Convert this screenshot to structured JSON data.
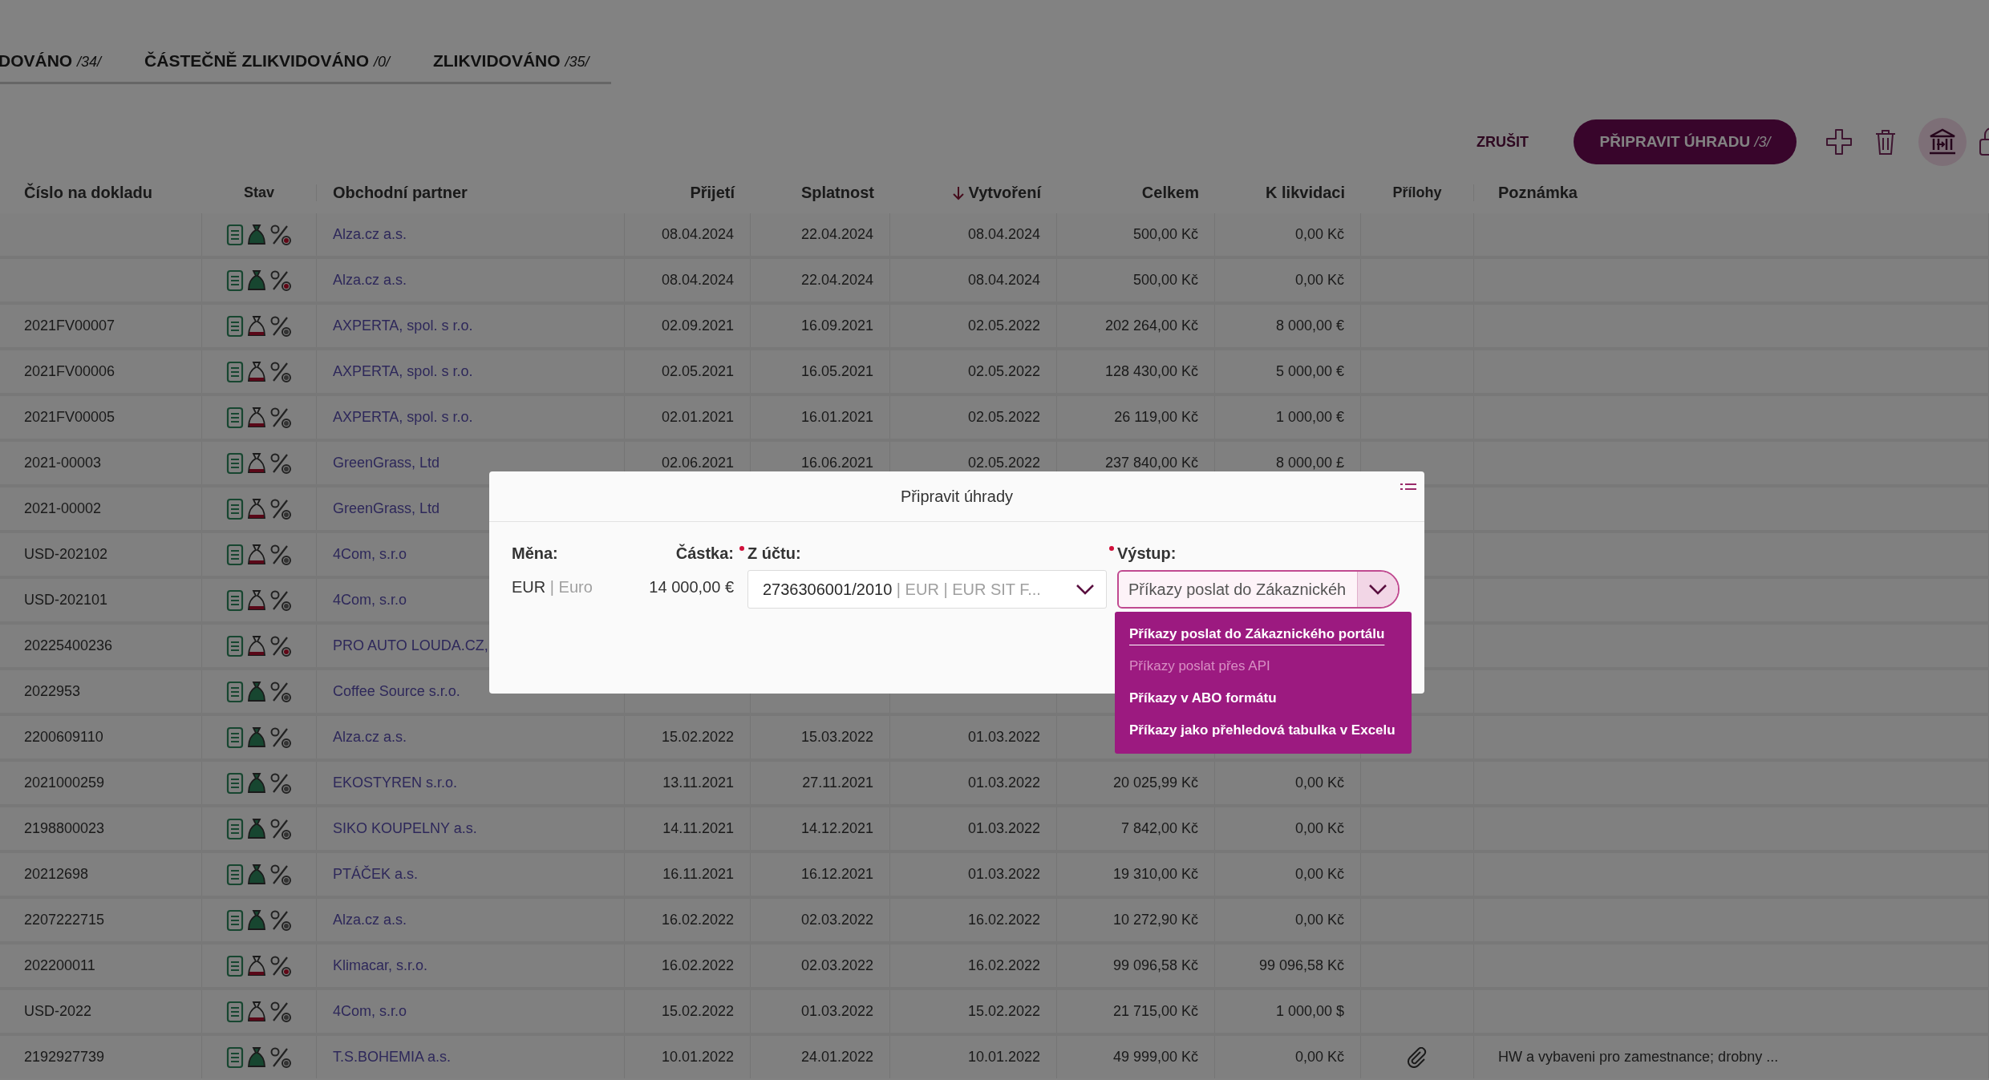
{
  "tabs": [
    {
      "label": "DOVÁNO",
      "count": "/34/",
      "selected": false
    },
    {
      "label": "ČÁSTEČNĚ ZLIKVIDOVÁNO",
      "count": "/0/",
      "selected": false
    },
    {
      "label": "ZLIKVIDOVÁNO",
      "count": "/35/",
      "selected": false
    }
  ],
  "actions": {
    "cancel": "ZRUŠIT",
    "primary": {
      "label": "PŘIPRAVIT ÚHRADU",
      "count": "/3/"
    }
  },
  "table": {
    "columns": [
      {
        "label": "Číslo na dokladu",
        "sorted": false
      },
      {
        "label": "Stav",
        "sorted": false
      },
      {
        "label": "Obchodní partner",
        "sorted": false
      },
      {
        "label": "Přijetí",
        "sorted": false
      },
      {
        "label": "Splatnost",
        "sorted": false
      },
      {
        "label": "Vytvoření",
        "sorted": true
      },
      {
        "label": "Celkem",
        "sorted": false
      },
      {
        "label": "K likvidaci",
        "sorted": false
      },
      {
        "label": "Přílohy",
        "sorted": false
      },
      {
        "label": "Poznámka",
        "sorted": false
      }
    ],
    "rows": [
      {
        "partner": "Alza.cz a.s.",
        "received": "08.04.2024",
        "due": "22.04.2024",
        "created": "08.04.2024",
        "total": "500,00 Kč",
        "to_pay": "0,00 Kč",
        "bag_full": true,
        "percent_alert": true,
        "attachment": false
      },
      {
        "partner": "Alza.cz a.s.",
        "received": "08.04.2024",
        "due": "22.04.2024",
        "created": "08.04.2024",
        "total": "500,00 Kč",
        "to_pay": "0,00 Kč",
        "bag_full": true,
        "percent_alert": true,
        "attachment": false
      },
      {
        "number": "2021FV00007",
        "partner": "AXPERTA, spol. s r.o.",
        "received": "02.09.2021",
        "due": "16.09.2021",
        "created": "02.05.2022",
        "total": "202 264,00 Kč",
        "to_pay": "8 000,00 €",
        "bag_full": false,
        "percent_alert": false,
        "attachment": false
      },
      {
        "number": "2021FV00006",
        "partner": "AXPERTA, spol. s r.o.",
        "received": "02.05.2021",
        "due": "16.05.2021",
        "created": "02.05.2022",
        "total": "128 430,00 Kč",
        "to_pay": "5 000,00 €",
        "bag_full": false,
        "percent_alert": false,
        "attachment": false
      },
      {
        "number": "2021FV00005",
        "partner": "AXPERTA, spol. s r.o.",
        "received": "02.01.2021",
        "due": "16.01.2021",
        "created": "02.05.2022",
        "total": "26 119,00 Kč",
        "to_pay": "1 000,00 €",
        "bag_full": false,
        "percent_alert": false,
        "attachment": false
      },
      {
        "number": "2021-00003",
        "partner": "GreenGrass, Ltd",
        "received": "02.06.2021",
        "due": "16.06.2021",
        "created": "02.05.2022",
        "total": "237 840,00 Kč",
        "to_pay": "8 000,00 £",
        "bag_full": false,
        "percent_alert": false,
        "attachment": false
      },
      {
        "number": "2021-00002",
        "partner": "GreenGrass, Ltd",
        "bag_full": false,
        "percent_alert": false,
        "attachment": false
      },
      {
        "number": "USD-202102",
        "partner": "4Com, s.r.o",
        "bag_full": false,
        "percent_alert": false,
        "attachment": false
      },
      {
        "number": "USD-202101",
        "partner": "4Com, s.r.o",
        "bag_full": false,
        "percent_alert": false,
        "attachment": false
      },
      {
        "number": "20225400236",
        "partner": "PRO AUTO LOUDA.CZ,",
        "bag_full": false,
        "percent_alert": true,
        "attachment": false
      },
      {
        "number": "2022953",
        "partner": "Coffee Source s.r.o.",
        "bag_full": true,
        "percent_alert": false,
        "attachment": false
      },
      {
        "number": "2200609110",
        "partner": "Alza.cz a.s.",
        "received": "15.02.2022",
        "due": "15.03.2022",
        "created": "01.03.2022",
        "bag_full": true,
        "percent_alert": false,
        "attachment": false
      },
      {
        "number": "2021000259",
        "partner": "EKOSTYREN s.r.o.",
        "received": "13.11.2021",
        "due": "27.11.2021",
        "created": "01.03.2022",
        "total": "20 025,99 Kč",
        "to_pay": "0,00 Kč",
        "bag_full": true,
        "percent_alert": false,
        "attachment": false
      },
      {
        "number": "2198800023",
        "partner": "SIKO KOUPELNY a.s.",
        "received": "14.11.2021",
        "due": "14.12.2021",
        "created": "01.03.2022",
        "total": "7 842,00 Kč",
        "to_pay": "0,00 Kč",
        "bag_full": true,
        "percent_alert": false,
        "attachment": false
      },
      {
        "number": "20212698",
        "partner": "PTÁČEK a.s.",
        "received": "16.11.2021",
        "due": "16.12.2021",
        "created": "01.03.2022",
        "total": "19 310,00 Kč",
        "to_pay": "0,00 Kč",
        "bag_full": true,
        "percent_alert": false,
        "attachment": false
      },
      {
        "number": "2207222715",
        "partner": "Alza.cz a.s.",
        "received": "16.02.2022",
        "due": "02.03.2022",
        "created": "16.02.2022",
        "total": "10 272,90 Kč",
        "to_pay": "0,00 Kč",
        "bag_full": true,
        "percent_alert": false,
        "attachment": false
      },
      {
        "number": "202200011",
        "partner": "Klimacar, s.r.o.",
        "received": "16.02.2022",
        "due": "02.03.2022",
        "created": "16.02.2022",
        "total": "99 096,58 Kč",
        "to_pay": "99 096,58 Kč",
        "bag_full": false,
        "percent_alert": true,
        "attachment": false
      },
      {
        "number": "USD-2022",
        "partner": "4Com, s.r.o",
        "received": "15.02.2022",
        "due": "01.03.2022",
        "created": "15.02.2022",
        "total": "21 715,00 Kč",
        "to_pay": "1 000,00 $",
        "bag_full": false,
        "percent_alert": false,
        "attachment": false
      },
      {
        "number": "2192927739",
        "partner": "T.S.BOHEMIA a.s.",
        "received": "10.01.2022",
        "due": "24.01.2022",
        "created": "10.01.2022",
        "total": "49 999,00 Kč",
        "to_pay": "0,00 Kč",
        "bag_full": true,
        "percent_alert": false,
        "attachment": true,
        "note": "HW a vybaveni pro zamestnance; drobny ..."
      }
    ]
  },
  "modal": {
    "title": "Připravit úhrady",
    "currency": {
      "label": "Měna:",
      "code": "EUR",
      "name": "| Euro"
    },
    "amount": {
      "label": "Částka:",
      "value": "14 000,00 €"
    },
    "account": {
      "label": "Z účtu:",
      "required": true,
      "value": "2736306001/2010",
      "detail": "| EUR | EUR SIT F..."
    },
    "output": {
      "label": "Výstup:",
      "required": true,
      "value": "Příkazy poslat do Zákaznickéh",
      "options": [
        {
          "label": "Příkazy poslat do Zákaznického portálu",
          "selected": true,
          "disabled": false
        },
        {
          "label": "Příkazy poslat přes API",
          "selected": false,
          "disabled": true
        },
        {
          "label": "Příkazy v ABO formátu",
          "selected": false,
          "disabled": false
        },
        {
          "label": "Příkazy jako přehledová tabulka v Excelu",
          "selected": false,
          "disabled": false
        }
      ]
    }
  }
}
